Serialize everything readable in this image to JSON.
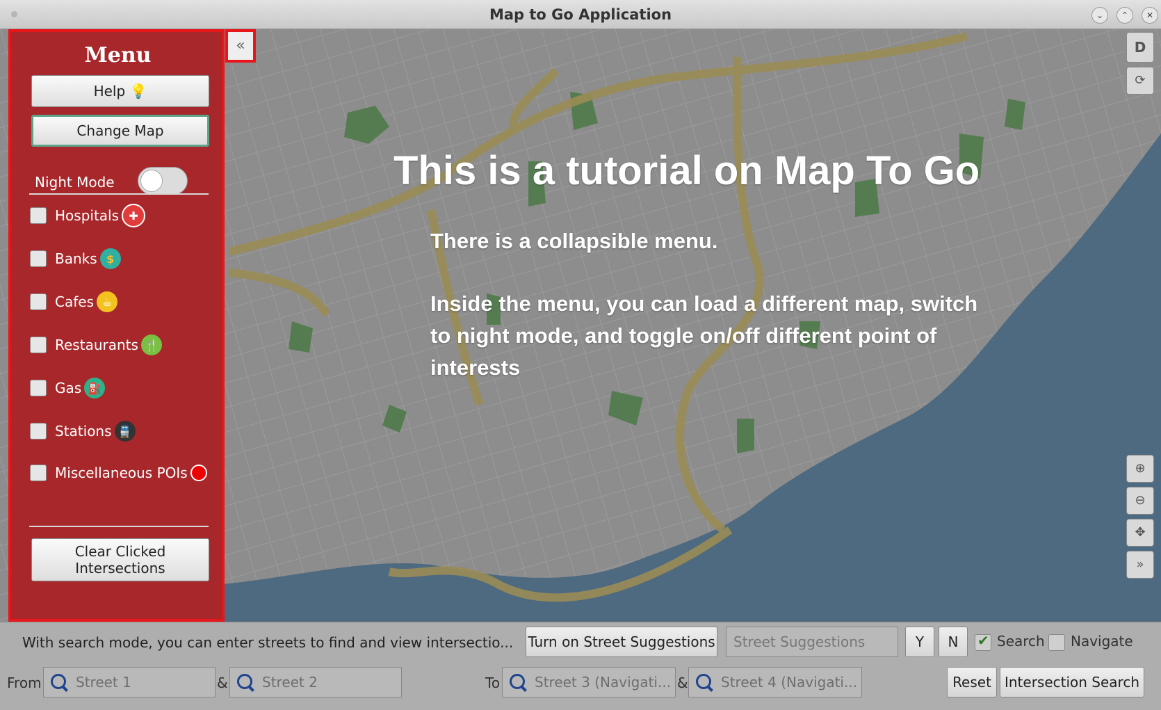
{
  "window": {
    "title": "Map to Go Application"
  },
  "tutorial": {
    "heading": "This is a tutorial on Map To Go",
    "line1": "There is a collapsible menu.",
    "line2": "Inside the menu, you can load a different map, switch to night mode, and toggle on/off different point of interests"
  },
  "menu": {
    "title": "Menu",
    "help_label": "Help",
    "change_map_label": "Change Map",
    "night_mode_label": "Night Mode",
    "night_mode_on": false,
    "pois": [
      {
        "label": "Hospitals",
        "icon": "hospital-icon",
        "checked": false
      },
      {
        "label": "Banks",
        "icon": "bank-icon",
        "checked": false
      },
      {
        "label": "Cafes",
        "icon": "cafe-icon",
        "checked": false
      },
      {
        "label": "Restaurants",
        "icon": "restaurant-icon",
        "checked": false
      },
      {
        "label": "Gas",
        "icon": "gas-icon",
        "checked": false
      },
      {
        "label": "Stations",
        "icon": "station-icon",
        "checked": false
      },
      {
        "label": "Miscellaneous POIs",
        "icon": "misc-poi-icon",
        "checked": false
      }
    ],
    "clear_label_line1": "Clear Clicked",
    "clear_label_line2": "Intersections"
  },
  "map_controls": {
    "d_label": "D"
  },
  "bottom": {
    "info": "With search mode, you can enter streets to find and view intersectio...",
    "suggestions_button": "Turn on Street Suggestions",
    "suggestions_placeholder": "Street Suggestions",
    "yes_label": "Y",
    "no_label": "N",
    "search_label": "Search",
    "search_checked": true,
    "navigate_label": "Navigate",
    "navigate_checked": false,
    "from_label": "From",
    "to_label": "To",
    "amp": "&",
    "street1": "Street 1",
    "street2": "Street 2",
    "street3": "Street 3 (Navigati...",
    "street4": "Street 4 (Navigati...",
    "reset_label": "Reset",
    "intersection_search_label": "Intersection Search"
  },
  "colors": {
    "menu_bg": "#a8272b",
    "highlight": "#e8151b",
    "water": "#4d6a80",
    "park": "#4f7a4a",
    "highway": "#9a8c55"
  }
}
